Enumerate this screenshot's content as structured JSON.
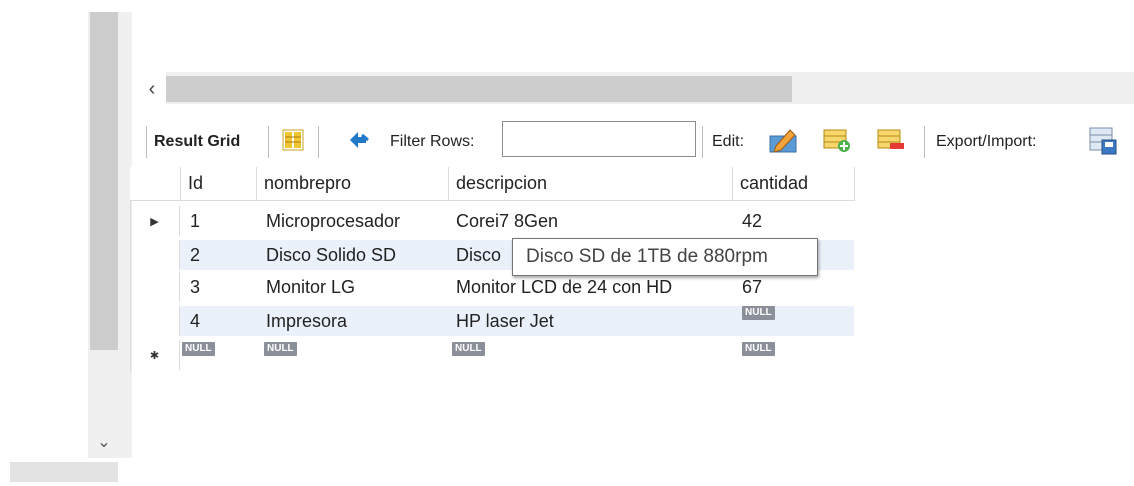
{
  "scroll": {
    "left_arrow": "‹",
    "down_arrow": "⌄"
  },
  "toolbar": {
    "result_grid": "Result Grid",
    "filter_rows": "Filter Rows:",
    "filter_value": "",
    "edit": "Edit:",
    "export_import": "Export/Import:"
  },
  "grid": {
    "columns": [
      "Id",
      "nombrepro",
      "descripcion",
      "cantidad"
    ],
    "rows": [
      {
        "id": "1",
        "nombrepro": "Microprocesador",
        "descripcion": "Corei7 8Gen",
        "cantidad": "42"
      },
      {
        "id": "2",
        "nombrepro": "Disco Solido SD",
        "descripcion": "Disco",
        "cantidad": ""
      },
      {
        "id": "3",
        "nombrepro": "Monitor LG",
        "descripcion": "Monitor LCD de 24 con HD",
        "cantidad": "67"
      },
      {
        "id": "4",
        "nombrepro": "Impresora",
        "descripcion": "HP laser Jet",
        "cantidad": "NULL"
      }
    ],
    "new_row": {
      "id": "NULL",
      "nombrepro": "NULL",
      "descripcion": "NULL",
      "cantidad": "NULL"
    },
    "current_marker": "▶",
    "new_marker": "✱"
  },
  "tooltip": {
    "text": "Disco SD de 1TB de 880rpm"
  },
  "colors": {
    "row_alt": "#eaf1fb",
    "null_badge": "#8a8f99",
    "scroll_thumb": "#cdcdcd"
  }
}
